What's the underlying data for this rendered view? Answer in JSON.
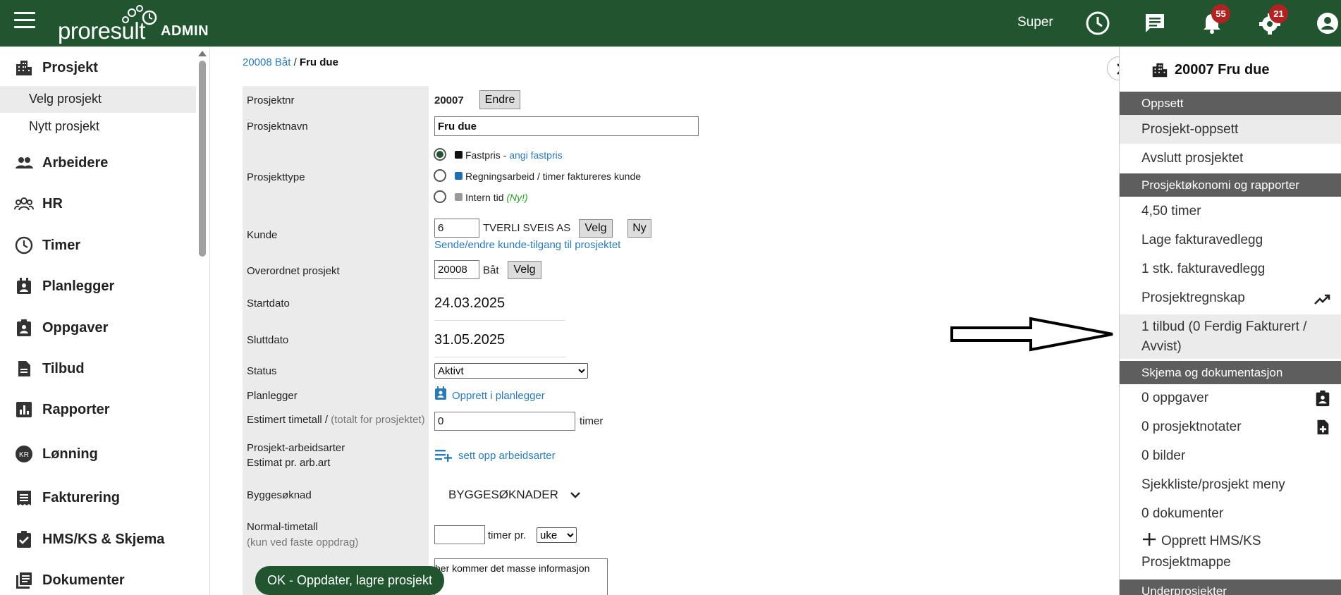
{
  "header": {
    "logo_text": "proresult",
    "logo_admin": "ADMIN",
    "user": "Super",
    "messages_badge": "55",
    "settings_badge": "21"
  },
  "sidebar": {
    "sections": [
      {
        "label": "Prosjekt",
        "icon": "building-icon"
      },
      {
        "label": "Arbeidere",
        "icon": "people-icon"
      },
      {
        "label": "HR",
        "icon": "group-icon"
      },
      {
        "label": "Timer",
        "icon": "clock-icon"
      },
      {
        "label": "Planlegger",
        "icon": "calendar-person-icon"
      },
      {
        "label": "Oppgaver",
        "icon": "clipboard-person-icon"
      },
      {
        "label": "Tilbud",
        "icon": "document-icon"
      },
      {
        "label": "Rapporter",
        "icon": "bar-chart-icon"
      },
      {
        "label": "Lønning",
        "icon": "kr-coin-icon"
      },
      {
        "label": "Fakturering",
        "icon": "receipt-icon"
      },
      {
        "label": "HMS/KS & Skjema",
        "icon": "clipboard-check-icon"
      },
      {
        "label": "Dokumenter",
        "icon": "library-books-icon"
      }
    ],
    "sub_items": [
      {
        "label": "Velg prosjekt"
      },
      {
        "label": "Nytt prosjekt"
      }
    ]
  },
  "breadcrumb": {
    "parent": "20008 Båt",
    "separator": "/",
    "current": "Fru due"
  },
  "form": {
    "labels": {
      "prosjektnr": "Prosjektnr",
      "prosjektnavn": "Prosjektnavn",
      "prosjekttype": "Prosjekttype",
      "kunde": "Kunde",
      "overordnet": "Overordnet prosjekt",
      "startdato": "Startdato",
      "sluttdato": "Sluttdato",
      "status": "Status",
      "planlegger": "Planlegger",
      "estimert": "Estimert timetall /",
      "estimert_note": "(totalt for prosjektet)",
      "arbeidsarter": "Prosjekt-arbeidsarter",
      "arbeidsarter2": "Estimat pr. arb.art",
      "byggesoknad": "Byggesøknad",
      "normal": "Normal-timetall",
      "normal_note": "(kun ved faste oppdrag)"
    },
    "prosjektnr_value": "20007",
    "endre_label": "Endre",
    "prosjektnavn_value": "Fru due",
    "types": [
      {
        "label": "Fastpris - ",
        "link": "angi fastpris",
        "color": "#111111",
        "checked": true
      },
      {
        "label": "Regningsarbeid / timer faktureres kunde",
        "link": "",
        "color": "#1f6fb0",
        "checked": false
      },
      {
        "label": "Intern tid ",
        "link": "",
        "note": "(Ny!)",
        "color": "#999999",
        "checked": false
      }
    ],
    "kunde_nr": "6",
    "kunde_name": "TVERLI SVEIS AS",
    "velg_label": "Velg",
    "ny_label": "Ny",
    "kunde_link": "Sende/endre kunde-tilgang til prosjektet",
    "overordnet_nr": "20008",
    "overordnet_name": "Båt",
    "startdato_value": "24.03.2025",
    "sluttdato_value": "31.05.2025",
    "status_value": "Aktivt",
    "planlegger_link": "Opprett i planlegger",
    "estimert_value": "0",
    "timer_unit": "timer",
    "arbeidsarter_link": "sett opp arbeidsarter",
    "byggesoknad_value": "BYGGESØKNADER",
    "normal_value": "",
    "timer_pr": "timer pr.",
    "period_value": "uke",
    "notes_value": "her kommer det masse informasjon",
    "ok_button": "OK - Oppdater, lagre prosjekt"
  },
  "right_panel": {
    "title": "20007 Fru due",
    "headers": [
      "Oppsett",
      "Prosjektøkonomi og rapporter",
      "Skjema og dokumentasjon",
      "Underprosjekter"
    ],
    "items": {
      "prosjekt_oppsett": "Prosjekt-oppsett",
      "avslutt": "Avslutt prosjektet",
      "timer": "4,50 timer",
      "lage_faktura": "Lage fakturavedlegg",
      "stk_faktura": "1 stk. fakturavedlegg",
      "regnskap": "Prosjektregnskap",
      "tilbud_line1": "1 tilbud (0 Ferdig Fakturert /",
      "tilbud_line2": "Avvist)",
      "oppgaver": "0 oppgaver",
      "notater": "0 prosjektnotater",
      "bilder": "0 bilder",
      "sjekkliste": "Sjekkliste/prosjekt meny",
      "dokumenter": "0 dokumenter",
      "opprett_hms": "Opprett HMS/KS",
      "prosjektmappe": "Prosjektmappe"
    }
  }
}
